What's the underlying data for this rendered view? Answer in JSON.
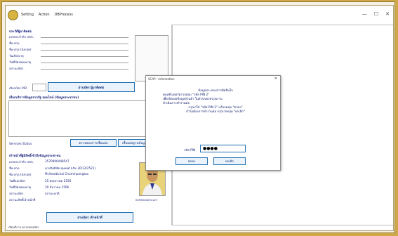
{
  "menu": {
    "setting": "Setting",
    "action": "Action",
    "process": "DBProcess"
  },
  "window_controls": {
    "minimize": "—",
    "maximize": "☐",
    "close": "✕"
  },
  "card_holder": {
    "title": "ประวัติผู้มาติดต่อ",
    "fields": [
      "เลขประจำตัว ปชช.",
      "ชื่อ-สกุล",
      "ชื่อ-สกุล (อังกฤษ)",
      "วันเกิด/อายุ",
      "วันที่บัตรหมดอายุ",
      "สถานะบัตร"
    ],
    "select_label": "เลือกบัตร PID",
    "read_button": "อ่านบัตร ผู้มาติดต่อ"
  },
  "service": {
    "title": "เลือกบริการข้อมูลจากรัฐ ออนไลน์ (ข้อมูลประชาชน)",
    "status_label": "Services Status",
    "check_button": "ตรวจสอบการเชื่อมต่อ",
    "connect_button": "เชื่อมต่อฐานข้อมูล"
  },
  "officer": {
    "title": "เจ้าหน้าที่ผู้มีสิทธิ์เข้าถึงข้อมูลประชาชน",
    "labels": [
      "เลขประจำตัว ปชช.",
      "ชื่อ-สกุล",
      "ชื่อ-สกุล (อังกฤษ)",
      "วันที่ออกบัตร",
      "วันที่บัตรหมดอายุ",
      "สถานะบัตร",
      "สถานะสิทธิ์เจ้าหน้าที่"
    ],
    "values": [
      "3570900448547",
      "นายกิตติชัย ชุมพงศ์ (เกิด 30/12/2521)",
      "Mr.Keattichai Chummpongtoo",
      "25 พฤษภาคม 2556",
      "29 ธันวาคม 2566",
      "สถานะปกติ"
    ],
    "photo_id": "0399040251127",
    "read_button": "อ่านบัตร เจ้าหน้าที่"
  },
  "status_bar": "เปิดบริการ ตรวจสอบบัตร",
  "dialog": {
    "title": "SCAP : Information",
    "close": "✕",
    "message": [
      "ข้อมูลประกอบการตัดสินใจ",
      "คอมพิวเตอร์ตรวจสอบ \"รหัส PIN 2\"",
      "เพื่อเปิดเผยข้อมูลส่วนตัว ในส่วนของหน่วยงาน",
      "ดำเนินการทำงานต่อ",
      "กรุณาใส่ \"รหัส PIN 2\" แล้วกดปุ่ม \"ตกลง\"",
      "ถ้าไม่ต้องการทำงานต่อ กรุณากดปุ่ม \"ยกเลิก\""
    ],
    "pin_label": "รหัส PIN",
    "pin_value": "●●●●",
    "ok": "ตกลง",
    "cancel": "ยกเลิก"
  },
  "colors": {
    "frame": "#cfa84a",
    "accent": "#1f6fb4",
    "text": "#1a237e"
  }
}
